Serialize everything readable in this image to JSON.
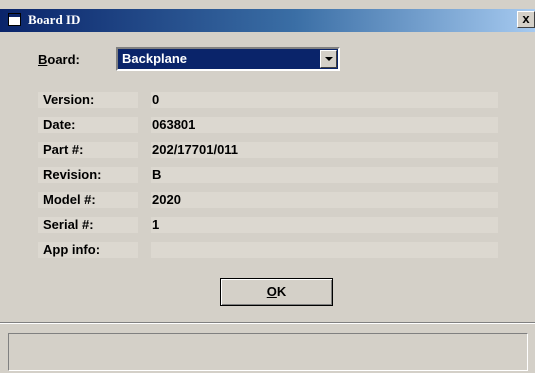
{
  "window": {
    "title": "Board ID",
    "close_glyph": "x",
    "title_icon": "window-icon",
    "close_icon": "close-icon"
  },
  "board": {
    "label_access_key": "B",
    "label_rest": "oard:",
    "selected_value": "Backplane"
  },
  "fields": [
    {
      "label": "Version:",
      "value": "0"
    },
    {
      "label": "Date:",
      "value": "063801"
    },
    {
      "label": "Part #:",
      "value": "202/17701/011"
    },
    {
      "label": "Revision:",
      "value": "B"
    },
    {
      "label": "Model #:",
      "value": "2020"
    },
    {
      "label": "Serial #:",
      "value": "1"
    },
    {
      "label": "App info:",
      "value": ""
    }
  ],
  "ok_button": {
    "access_key": "O",
    "rest": "K"
  },
  "status_bar": {
    "text": ""
  },
  "colors": {
    "title_bar_start": "#0a246a",
    "title_bar_end": "#a6caf0",
    "window_face": "#d4d0c8",
    "selection": "#0a246a"
  }
}
